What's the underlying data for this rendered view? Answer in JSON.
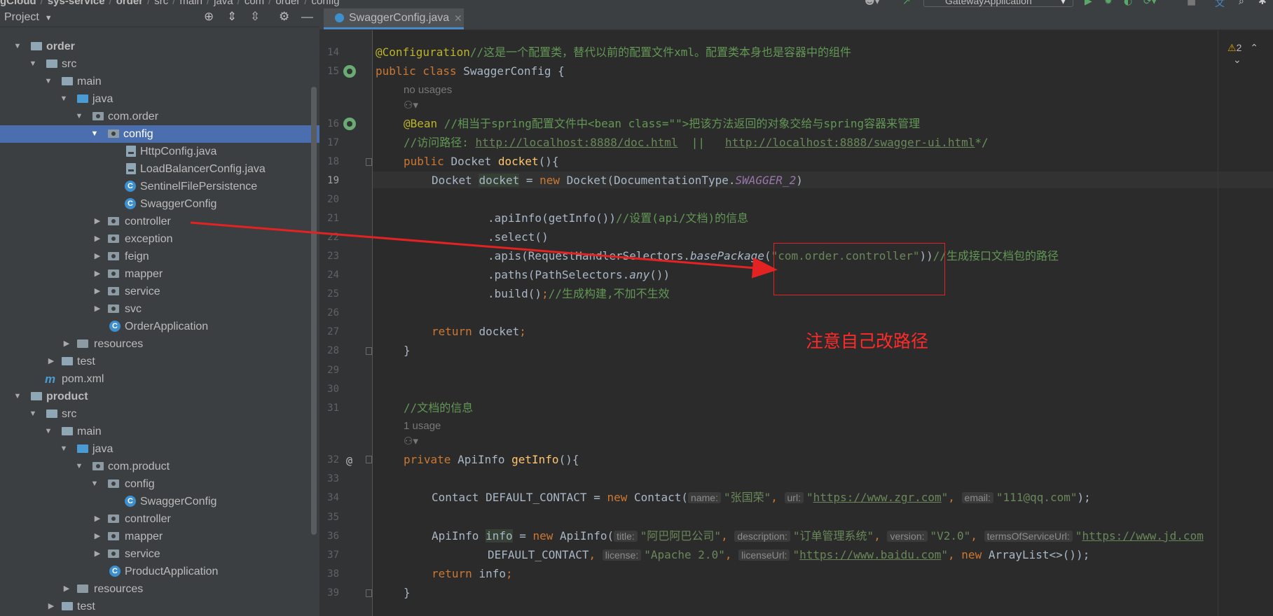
{
  "breadcrumb": [
    "gCloud",
    "sys-service",
    "order",
    "src",
    "main",
    "java",
    "com",
    "order",
    "config"
  ],
  "run_config": "GatewayApplication",
  "project_panel": {
    "title": "Project",
    "tree": [
      {
        "label": "order",
        "bold": true
      },
      {
        "label": "src"
      },
      {
        "label": "main"
      },
      {
        "label": "java"
      },
      {
        "label": "com.order"
      },
      {
        "label": "config",
        "selected": true
      },
      {
        "label": "HttpConfig.java"
      },
      {
        "label": "LoadBalancerConfig.java"
      },
      {
        "label": "SentinelFilePersistence"
      },
      {
        "label": "SwaggerConfig"
      },
      {
        "label": "controller"
      },
      {
        "label": "exception"
      },
      {
        "label": "feign"
      },
      {
        "label": "mapper"
      },
      {
        "label": "service"
      },
      {
        "label": "svc"
      },
      {
        "label": "OrderApplication"
      },
      {
        "label": "resources"
      },
      {
        "label": "test"
      },
      {
        "label": "pom.xml"
      },
      {
        "label": "product",
        "bold": true
      },
      {
        "label": "src"
      },
      {
        "label": "main"
      },
      {
        "label": "java"
      },
      {
        "label": "com.product"
      },
      {
        "label": "config"
      },
      {
        "label": "SwaggerConfig"
      },
      {
        "label": "controller"
      },
      {
        "label": "mapper"
      },
      {
        "label": "service"
      },
      {
        "label": "ProductApplication"
      },
      {
        "label": "resources"
      },
      {
        "label": "test"
      }
    ]
  },
  "editor": {
    "tab_label": "SwaggerConfig.java",
    "warning_count": "2",
    "line_numbers": [
      "14",
      "15",
      "16",
      "17",
      "18",
      "19",
      "20",
      "21",
      "22",
      "23",
      "24",
      "25",
      "26",
      "27",
      "28",
      "29",
      "30",
      "31",
      "32",
      "33",
      "34",
      "35",
      "36",
      "37",
      "38",
      "39"
    ],
    "usages": {
      "none": "no usages",
      "one": "1 usage"
    },
    "code": {
      "l14_ann": "@Configuration",
      "l14_cm": "//这是一个配置类，替代以前的配置文件xml。配置类本身也是容器中的组件",
      "l15_kw": "public class ",
      "l15_rest": "SwaggerConfig {",
      "l16_ann": "@Bean",
      "l16_cm": " //相当于spring配置文件中<bean class=\"\">把该方法返回的对象交给与spring容器来管理",
      "l17_cm1": "//访问路径: ",
      "l17_url1": "http://localhost:8888/doc.html",
      "l17_cm2": "  ||   ",
      "l17_url2": "http://localhost:8888/swagger-ui.html",
      "l17_cm3": "*/",
      "l18_kw": "public ",
      "l18_type": "Docket ",
      "l18_fn": "docket",
      "l18_rest": "(){",
      "l19_a": "Docket ",
      "l19_var": "docket",
      "l19_b": " = ",
      "l19_kw": "new ",
      "l19_c": "Docket(DocumentationType.",
      "l19_it": "SWAGGER_2",
      "l19_d": ")",
      "l21_code": ".apiInfo(getInfo())",
      "l21_cm": "//设置(api/文档)的信息",
      "l22_code": ".select()",
      "l23_a": ".apis(RequestHandlerSelectors.",
      "l23_it": "basePackage",
      "l23_b": "(",
      "l23_str": "\"com.order.controller\"",
      "l23_c": "))",
      "l23_cm": "//生成接口文档包的路径",
      "l24_a": ".paths(PathSelectors.",
      "l24_it": "any",
      "l24_b": "())",
      "l25_a": ".build()",
      "l25_kw": ";",
      "l25_cm": "//生成构建,不加不生效",
      "l27_kw": "return ",
      "l27_rest": "docket",
      "l27_semi": ";",
      "l28": "}",
      "l31_cm": "//文档的信息",
      "l32_kw": "private ",
      "l32_type": "ApiInfo ",
      "l32_fn": "getInfo",
      "l32_rest": "(){",
      "l34_a": "Contact DEFAULT_CONTACT = ",
      "l34_kw": "new ",
      "l34_b": "Contact(",
      "l34_h1": "name:",
      "l34_s1": "\"张国荣\"",
      "l34_c1": ", ",
      "l34_h2": "url:",
      "l34_s2q1": "\"",
      "l34_s2u": "https://www.zgr.com",
      "l34_s2q2": "\"",
      "l34_c2": ", ",
      "l34_h3": "email:",
      "l34_s3": "\"111@qq.com\"",
      "l34_end": ");",
      "l36_a": "ApiInfo ",
      "l36_var": "info",
      "l36_b": " = ",
      "l36_kw": "new ",
      "l36_c": "ApiInfo(",
      "l36_h1": "title:",
      "l36_s1": "\"阿巴阿巴公司\"",
      "l36_c1": ", ",
      "l36_h2": "description:",
      "l36_s2": "\"订单管理系统\"",
      "l36_c2": ", ",
      "l36_h3": "version:",
      "l36_s3": "\"V2.0\"",
      "l36_c3": ", ",
      "l36_h4": "termsOfServiceUrl:",
      "l36_s4q": "\"",
      "l36_s4u": "https://www.jd.com",
      "l37_a": "DEFAULT_CONTACT",
      "l37_c1": ", ",
      "l37_h1": "license:",
      "l37_s1": "\"Apache 2.0\"",
      "l37_c2": ", ",
      "l37_h2": "licenseUrl:",
      "l37_s2q1": "\"",
      "l37_s2u": "https://www.baidu.com",
      "l37_s2q2": "\"",
      "l37_c3": ", ",
      "l37_kw": "new ",
      "l37_end": "ArrayList<>());",
      "l38_kw": "return ",
      "l38_rest": "info",
      "l38_semi": ";",
      "l39": "}"
    }
  },
  "annotation": {
    "note": "注意自己改路径",
    "color": "#e32222"
  }
}
